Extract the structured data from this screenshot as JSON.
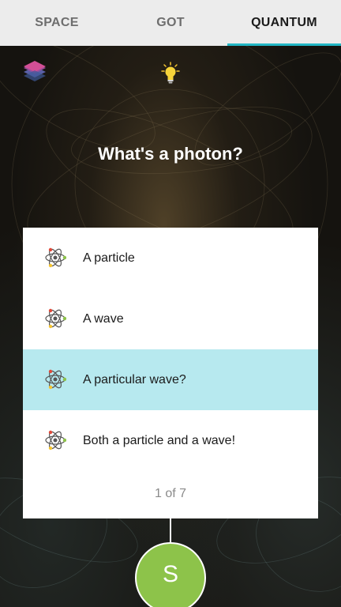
{
  "tabs": [
    {
      "label": "SPACE",
      "active": false
    },
    {
      "label": "GOT",
      "active": false
    },
    {
      "label": "QUANTUM",
      "active": true
    }
  ],
  "toolbar": {
    "left_icon": "layers-icon",
    "center_icon": "lightbulb-icon"
  },
  "question": "What's a photon?",
  "options": [
    {
      "label": "A particle",
      "selected": false,
      "icon": "atom-icon"
    },
    {
      "label": "A wave",
      "selected": false,
      "icon": "atom-icon"
    },
    {
      "label": "A particular wave?",
      "selected": true,
      "icon": "atom-icon"
    },
    {
      "label": "Both a particle and a wave!",
      "selected": false,
      "icon": "atom-icon"
    }
  ],
  "pagination": "1 of 7",
  "user_button": {
    "initial": "S"
  },
  "colors": {
    "tab_bar_bg": "#ececec",
    "tab_indicator": "#23b7c5",
    "selected_option_bg": "#b7e9ef",
    "user_button_bg": "#8dc34a"
  }
}
